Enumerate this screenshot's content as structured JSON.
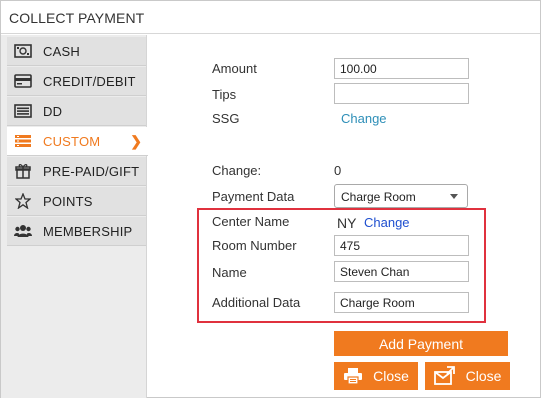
{
  "title": "COLLECT PAYMENT",
  "sidebar": {
    "items": [
      {
        "label": "CASH",
        "icon": "cash-icon"
      },
      {
        "label": "CREDIT/DEBIT",
        "icon": "credit-card-icon"
      },
      {
        "label": "DD",
        "icon": "list-icon"
      },
      {
        "label": "CUSTOM",
        "icon": "custom-list-icon",
        "active": true
      },
      {
        "label": "PRE-PAID/GIFT",
        "icon": "gift-icon"
      },
      {
        "label": "POINTS",
        "icon": "star-icon"
      },
      {
        "label": "MEMBERSHIP",
        "icon": "users-icon"
      }
    ]
  },
  "form": {
    "amount_label": "Amount",
    "amount_value": "100.00",
    "tips_label": "Tips",
    "tips_value": "",
    "ssg_label": "SSG",
    "ssg_link": "Change",
    "change_label": "Change:",
    "change_value": "0",
    "payment_data_label": "Payment Data",
    "payment_data_selected": "Charge Room",
    "center_name_label": "Center Name",
    "center_name_value": "NY",
    "center_name_link": "Change",
    "room_number_label": "Room Number",
    "room_number_value": "475",
    "name_label": "Name",
    "name_value": "Steven Chan",
    "additional_label": "Additional Data",
    "additional_value": "Charge Room"
  },
  "buttons": {
    "add_payment": "Add Payment",
    "print_close": "Close",
    "email_close": "Close"
  },
  "colors": {
    "accent": "#f07a1f",
    "highlight_border": "#e0313e",
    "link": "#2e8fb8"
  }
}
